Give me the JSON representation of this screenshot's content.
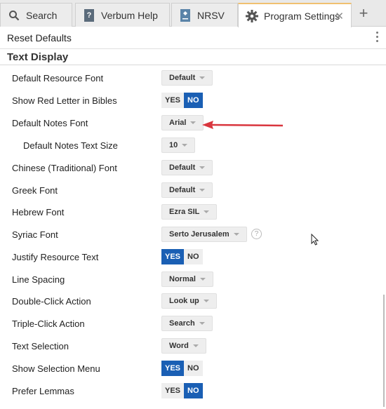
{
  "tabs": [
    {
      "label": "Search"
    },
    {
      "label": "Verbum Help"
    },
    {
      "label": "NRSV"
    },
    {
      "label": "Program Settings",
      "close": "✕"
    }
  ],
  "new_tab": "+",
  "toolbar": {
    "reset_label": "Reset Defaults"
  },
  "section": {
    "title": "Text Display"
  },
  "settings": [
    {
      "label": "Default Resource Font",
      "value": "Default"
    },
    {
      "label": "Show Red Letter in Bibles",
      "yes": "YES",
      "no": "NO",
      "selected": "NO"
    },
    {
      "label": "Default Notes Font",
      "value": "Arial"
    },
    {
      "label": "Default Notes Text Size",
      "value": "10"
    },
    {
      "label": "Chinese (Traditional) Font",
      "value": "Default"
    },
    {
      "label": "Greek Font",
      "value": "Default"
    },
    {
      "label": "Hebrew Font",
      "value": "Ezra SIL"
    },
    {
      "label": "Syriac Font",
      "value": "Serto Jerusalem",
      "help": "?"
    },
    {
      "label": "Justify Resource Text",
      "yes": "YES",
      "no": "NO",
      "selected": "YES"
    },
    {
      "label": "Line Spacing",
      "value": "Normal"
    },
    {
      "label": "Double-Click Action",
      "value": "Look up"
    },
    {
      "label": "Triple-Click Action",
      "value": "Search"
    },
    {
      "label": "Text Selection",
      "value": "Word"
    },
    {
      "label": "Show Selection Menu",
      "yes": "YES",
      "no": "NO",
      "selected": "YES"
    },
    {
      "label": "Prefer Lemmas",
      "yes": "YES",
      "no": "NO",
      "selected": "NO"
    }
  ],
  "colors": {
    "accent": "#1a5fb4",
    "arrow": "#d9363e",
    "active_tab_top": "#f0c070"
  }
}
